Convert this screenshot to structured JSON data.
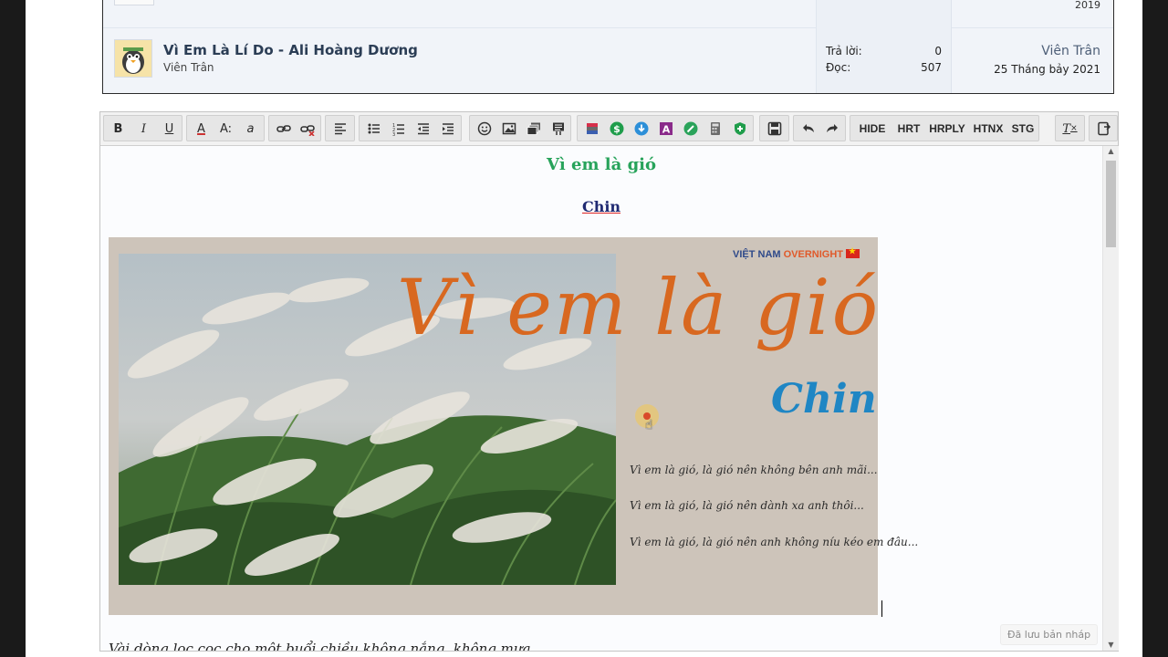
{
  "thread_list": {
    "prev_row": {
      "year": "2019"
    },
    "thread": {
      "title": "Vì Em Là Lí Do - Ali Hoàng Dương",
      "author": "Viên Trân",
      "replies_label": "Trả lời:",
      "replies_value": "0",
      "views_label": "Đọc:",
      "views_value": "507",
      "last_user": "Viên Trân",
      "last_date": "25 Tháng bảy 2021"
    }
  },
  "toolbar": {
    "bold": "B",
    "italic": "I",
    "underline": "U",
    "font_color": "A",
    "font_size": "A:",
    "font_family": "a",
    "hide": "HIDE",
    "hrt": "HRT",
    "hrply": "HRPLY",
    "htnx": "HTNX",
    "stg": "STG",
    "clear_format": "T"
  },
  "editor": {
    "song_title": "Vì em là gió",
    "song_author": "Chin",
    "image": {
      "brand_part1": "VIỆT NAM ",
      "brand_part2": "OVERNIGHT",
      "title": "Vì em là gió",
      "author": "Chin",
      "lyrics": [
        "Vì em là gió, là gió nên không bên anh mãi...",
        "Vì em là gió, là gió nên dành xa anh thôi...",
        "Vì em là gió, là gió nên anh không níu kéo em đâu..."
      ]
    },
    "footer_text": "Vài dòng lọc cọc cho một buổi chiều không nắng, không mưa",
    "draft_status": "Đã lưu bản nháp"
  },
  "colors": {
    "title_green": "#27a35a",
    "author_blue": "#202a72",
    "art_orange": "#d86820",
    "art_blue": "#1f86c4"
  }
}
